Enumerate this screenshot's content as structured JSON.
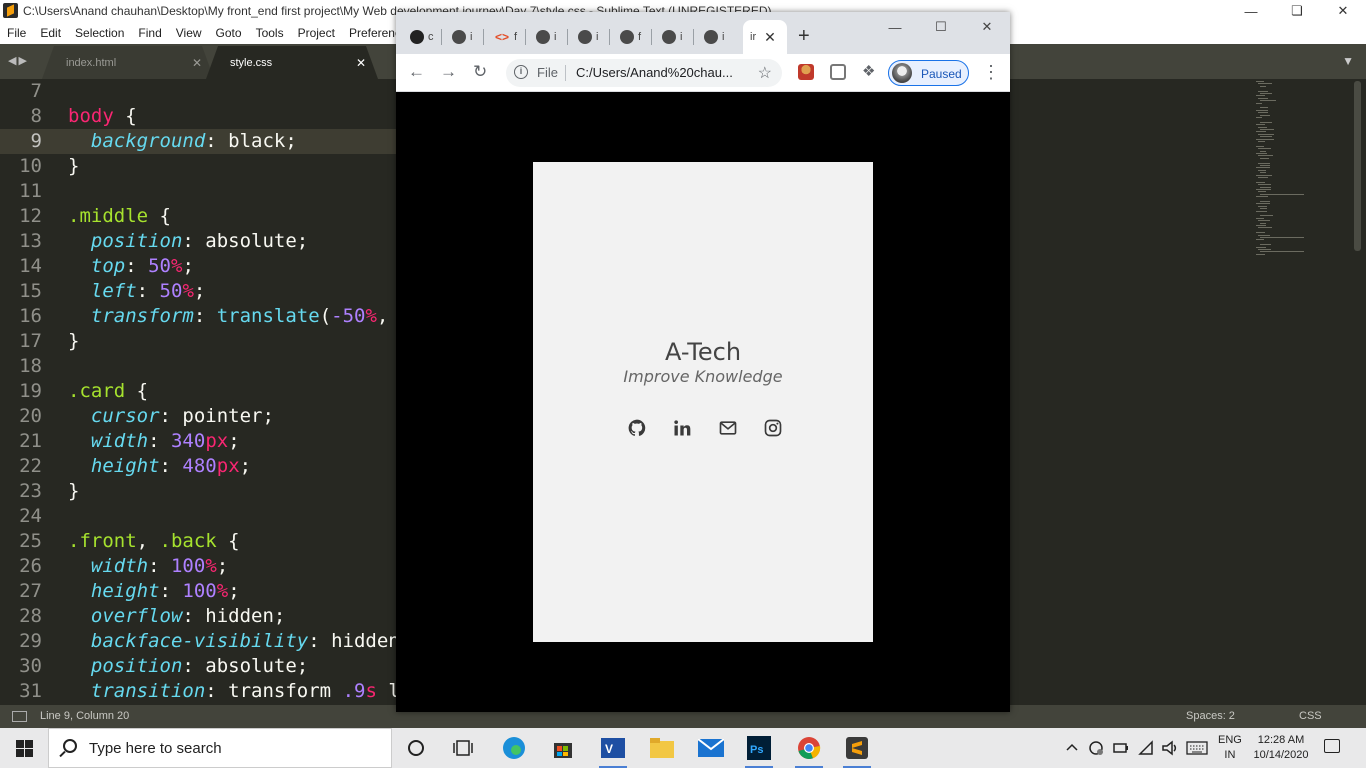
{
  "sublime": {
    "title": "C:\\Users\\Anand chauhan\\Desktop\\My front_end first project\\My Web development journey\\Day 7\\style.css - Sublime Text (UNREGISTERED)",
    "menu": [
      "File",
      "Edit",
      "Selection",
      "Find",
      "View",
      "Goto",
      "Tools",
      "Project",
      "Preferences"
    ],
    "tabs": [
      {
        "label": "index.html",
        "active": false
      },
      {
        "label": "style.css",
        "active": true
      }
    ],
    "active_line": 9,
    "code": [
      {
        "n": "7",
        "tokens": []
      },
      {
        "n": "8",
        "tokens": [
          {
            "t": "body",
            "c": "k-pink"
          },
          {
            "t": " {",
            "c": "k-plain"
          }
        ]
      },
      {
        "n": "9",
        "tokens": [
          {
            "t": "  ",
            "c": "k-plain"
          },
          {
            "t": "background",
            "c": "k-blue"
          },
          {
            "t": ": black;",
            "c": "k-plain"
          }
        ]
      },
      {
        "n": "10",
        "tokens": [
          {
            "t": "}",
            "c": "k-plain"
          }
        ]
      },
      {
        "n": "11",
        "tokens": []
      },
      {
        "n": "12",
        "tokens": [
          {
            "t": ".middle",
            "c": "k-green"
          },
          {
            "t": " {",
            "c": "k-plain"
          }
        ]
      },
      {
        "n": "13",
        "tokens": [
          {
            "t": "  ",
            "c": "k-plain"
          },
          {
            "t": "position",
            "c": "k-blue"
          },
          {
            "t": ": absolute;",
            "c": "k-plain"
          }
        ]
      },
      {
        "n": "14",
        "tokens": [
          {
            "t": "  ",
            "c": "k-plain"
          },
          {
            "t": "top",
            "c": "k-blue"
          },
          {
            "t": ": ",
            "c": "k-plain"
          },
          {
            "t": "50",
            "c": "k-num"
          },
          {
            "t": "%",
            "c": "k-unit"
          },
          {
            "t": ";",
            "c": "k-plain"
          }
        ]
      },
      {
        "n": "15",
        "tokens": [
          {
            "t": "  ",
            "c": "k-plain"
          },
          {
            "t": "left",
            "c": "k-blue"
          },
          {
            "t": ": ",
            "c": "k-plain"
          },
          {
            "t": "50",
            "c": "k-num"
          },
          {
            "t": "%",
            "c": "k-unit"
          },
          {
            "t": ";",
            "c": "k-plain"
          }
        ]
      },
      {
        "n": "16",
        "tokens": [
          {
            "t": "  ",
            "c": "k-plain"
          },
          {
            "t": "transform",
            "c": "k-blue"
          },
          {
            "t": ": ",
            "c": "k-plain"
          },
          {
            "t": "translate",
            "c": "k-fn"
          },
          {
            "t": "(",
            "c": "k-plain"
          },
          {
            "t": "-50",
            "c": "k-num"
          },
          {
            "t": "%",
            "c": "k-unit"
          },
          {
            "t": ",",
            "c": "k-plain"
          }
        ]
      },
      {
        "n": "17",
        "tokens": [
          {
            "t": "}",
            "c": "k-plain"
          }
        ]
      },
      {
        "n": "18",
        "tokens": []
      },
      {
        "n": "19",
        "tokens": [
          {
            "t": ".card",
            "c": "k-green"
          },
          {
            "t": " {",
            "c": "k-plain"
          }
        ]
      },
      {
        "n": "20",
        "tokens": [
          {
            "t": "  ",
            "c": "k-plain"
          },
          {
            "t": "cursor",
            "c": "k-blue"
          },
          {
            "t": ": pointer;",
            "c": "k-plain"
          }
        ]
      },
      {
        "n": "21",
        "tokens": [
          {
            "t": "  ",
            "c": "k-plain"
          },
          {
            "t": "width",
            "c": "k-blue"
          },
          {
            "t": ": ",
            "c": "k-plain"
          },
          {
            "t": "340",
            "c": "k-num"
          },
          {
            "t": "px",
            "c": "k-unit"
          },
          {
            "t": ";",
            "c": "k-plain"
          }
        ]
      },
      {
        "n": "22",
        "tokens": [
          {
            "t": "  ",
            "c": "k-plain"
          },
          {
            "t": "height",
            "c": "k-blue"
          },
          {
            "t": ": ",
            "c": "k-plain"
          },
          {
            "t": "480",
            "c": "k-num"
          },
          {
            "t": "px",
            "c": "k-unit"
          },
          {
            "t": ";",
            "c": "k-plain"
          }
        ]
      },
      {
        "n": "23",
        "tokens": [
          {
            "t": "}",
            "c": "k-plain"
          }
        ]
      },
      {
        "n": "24",
        "tokens": []
      },
      {
        "n": "25",
        "tokens": [
          {
            "t": ".front",
            "c": "k-green"
          },
          {
            "t": ", ",
            "c": "k-plain"
          },
          {
            "t": ".back",
            "c": "k-green"
          },
          {
            "t": " {",
            "c": "k-plain"
          }
        ]
      },
      {
        "n": "26",
        "tokens": [
          {
            "t": "  ",
            "c": "k-plain"
          },
          {
            "t": "width",
            "c": "k-blue"
          },
          {
            "t": ": ",
            "c": "k-plain"
          },
          {
            "t": "100",
            "c": "k-num"
          },
          {
            "t": "%",
            "c": "k-unit"
          },
          {
            "t": ";",
            "c": "k-plain"
          }
        ]
      },
      {
        "n": "27",
        "tokens": [
          {
            "t": "  ",
            "c": "k-plain"
          },
          {
            "t": "height",
            "c": "k-blue"
          },
          {
            "t": ": ",
            "c": "k-plain"
          },
          {
            "t": "100",
            "c": "k-num"
          },
          {
            "t": "%",
            "c": "k-unit"
          },
          {
            "t": ";",
            "c": "k-plain"
          }
        ]
      },
      {
        "n": "28",
        "tokens": [
          {
            "t": "  ",
            "c": "k-plain"
          },
          {
            "t": "overflow",
            "c": "k-blue"
          },
          {
            "t": ": hidden;",
            "c": "k-plain"
          }
        ]
      },
      {
        "n": "29",
        "tokens": [
          {
            "t": "  ",
            "c": "k-plain"
          },
          {
            "t": "backface-visibility",
            "c": "k-blue"
          },
          {
            "t": ": hidden",
            "c": "k-plain"
          }
        ]
      },
      {
        "n": "30",
        "tokens": [
          {
            "t": "  ",
            "c": "k-plain"
          },
          {
            "t": "position",
            "c": "k-blue"
          },
          {
            "t": ": absolute;",
            "c": "k-plain"
          }
        ]
      },
      {
        "n": "31",
        "tokens": [
          {
            "t": "  ",
            "c": "k-plain"
          },
          {
            "t": "transition",
            "c": "k-blue"
          },
          {
            "t": ": transform ",
            "c": "k-plain"
          },
          {
            "t": ".9",
            "c": "k-num"
          },
          {
            "t": "s",
            "c": "k-unit"
          },
          {
            "t": " l",
            "c": "k-plain"
          }
        ]
      }
    ],
    "status": {
      "position": "Line 9, Column 20",
      "spaces": "Spaces: 2",
      "syntax": "CSS"
    }
  },
  "chrome": {
    "tabs": [
      {
        "icon": "github-icon",
        "label": "c"
      },
      {
        "icon": "globe-icon",
        "label": "i"
      },
      {
        "icon": "code-icon",
        "label": "f"
      },
      {
        "icon": "globe-icon",
        "label": "i"
      },
      {
        "icon": "globe-icon",
        "label": "i"
      },
      {
        "icon": "globe-icon",
        "label": "f"
      },
      {
        "icon": "globe-icon",
        "label": "i"
      },
      {
        "icon": "globe-icon",
        "label": "i"
      }
    ],
    "active_tab": {
      "label": "ir"
    },
    "scheme": "File",
    "url": "C:/Users/Anand%20chau...",
    "profile_status": "Paused",
    "page": {
      "brand": "A-Tech",
      "tagline": "Improve Knowledge",
      "socials": [
        "github-icon",
        "linkedin-icon",
        "mail-icon",
        "instagram-icon"
      ]
    }
  },
  "taskbar": {
    "search_placeholder": "Type here to search",
    "language_top": "ENG",
    "language_bottom": "IN",
    "time": "12:28 AM",
    "date": "10/14/2020"
  },
  "colors": {
    "editor_bg": "#272822",
    "keyword_pink": "#f92672",
    "selector_green": "#a6e22e",
    "property_blue": "#66d9ef",
    "number_purple": "#ae81ff",
    "card_bg": "#f2f2f2",
    "page_bg": "#000000"
  }
}
